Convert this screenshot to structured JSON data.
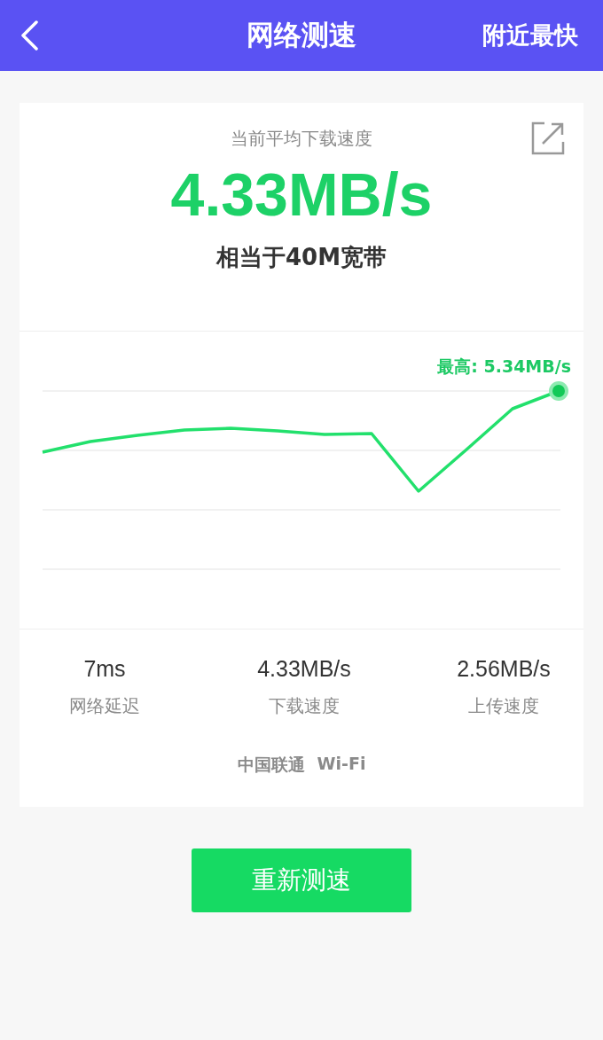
{
  "header": {
    "title": "网络测速",
    "action": "附近最快"
  },
  "result": {
    "caption": "当前平均下载速度",
    "speed": "4.33MB/s",
    "equivalent": "相当于40M宽带"
  },
  "chart": {
    "peak_label": "最高: 5.34MB/s"
  },
  "stats": [
    {
      "value": "7ms",
      "label": "网络延迟"
    },
    {
      "value": "4.33MB/s",
      "label": "下载速度"
    },
    {
      "value": "2.56MB/s",
      "label": "上传速度"
    }
  ],
  "network": {
    "carrier": "中国联通",
    "type": "Wi-Fi"
  },
  "retest_button": "重新测速"
}
